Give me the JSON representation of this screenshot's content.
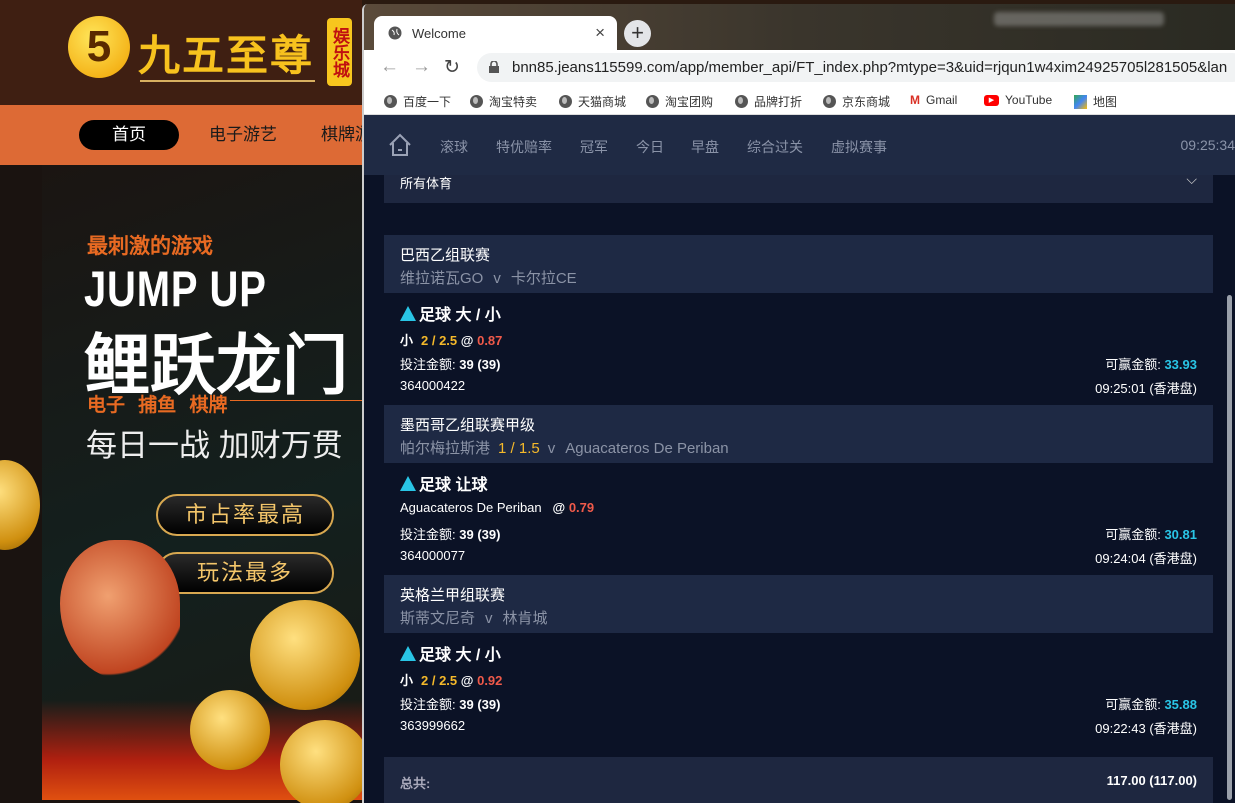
{
  "left_site": {
    "logo_text": "九五至尊",
    "logo_badge": "娱乐城",
    "nav": [
      "首页",
      "电子游艺",
      "棋牌游"
    ],
    "banner": {
      "tagline": "最刺激的游戏",
      "headline_en": "JUMP UP",
      "headline_cn": "鲤跃龙门",
      "categories": "电子 捕鱼 棋牌",
      "slogan": "每日一战 加财万贯",
      "button1": "市占率最高",
      "button2": "玩法最多"
    }
  },
  "browser": {
    "tab_title": "Welcome",
    "url": "bnn85.jeans115599.com/app/member_api/FT_index.php?mtype=3&uid=rjqun1w4xim24925705l281505&lan",
    "bookmarks": [
      "百度一下",
      "淘宝特卖",
      "天猫商城",
      "淘宝团购",
      "品牌打折",
      "京东商城",
      "Gmail",
      "YouTube",
      "地图"
    ]
  },
  "app": {
    "nav": [
      "滚球",
      "特优赔率",
      "冠军",
      "今日",
      "早盘",
      "综合过关",
      "虚拟赛事"
    ],
    "clock": "09:25:34",
    "sport_filter": "所有体育",
    "bets": [
      {
        "league": "巴西乙组联赛",
        "home": "维拉诺瓦GO",
        "handicap": "",
        "vs": "v",
        "away": "卡尔拉CE",
        "type": "足球 大 / 小",
        "pick": "小",
        "line": "2 / 2.5",
        "at": "@",
        "odds": "0.87",
        "stake_label": "投注金额:",
        "stake": "39 (39)",
        "win_label": "可赢金额:",
        "win": "33.93",
        "id": "364000422",
        "time": "09:25:01 (香港盘)"
      },
      {
        "league": "墨西哥乙组联赛甲级",
        "home": "帕尔梅拉斯港",
        "handicap": "1 / 1.5",
        "vs": "v",
        "away": "Aguacateros De Periban",
        "type": "足球 让球",
        "pick": "Aguacateros De Periban",
        "line": "",
        "at": "@",
        "odds": "0.79",
        "stake_label": "投注金额:",
        "stake": "39 (39)",
        "win_label": "可赢金额:",
        "win": "30.81",
        "id": "364000077",
        "time": "09:24:04 (香港盘)"
      },
      {
        "league": "英格兰甲组联赛",
        "home": "斯蒂文尼奇",
        "handicap": "",
        "vs": "v",
        "away": "林肯城",
        "type": "足球 大 / 小",
        "pick": "小",
        "line": "2 / 2.5",
        "at": "@",
        "odds": "0.92",
        "stake_label": "投注金额:",
        "stake": "39 (39)",
        "win_label": "可赢金额:",
        "win": "35.88",
        "id": "363999662",
        "time": "09:22:43 (香港盘)"
      }
    ],
    "total_label": "总共:",
    "total": "117.00 (117.00)"
  }
}
